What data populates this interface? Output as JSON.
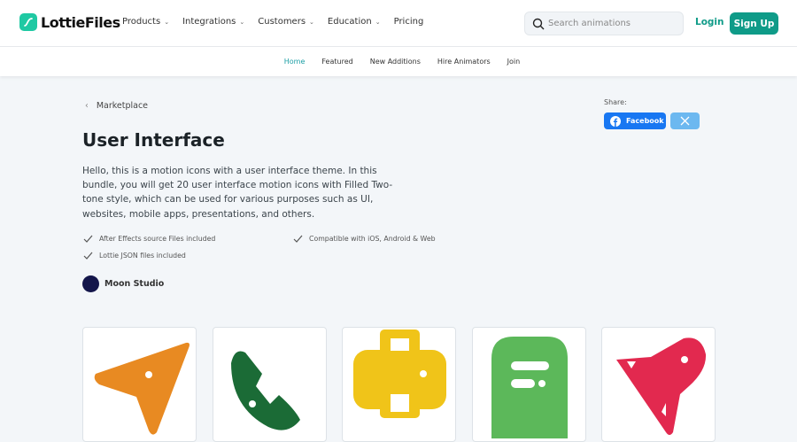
{
  "header": {
    "logo": "LottieFiles",
    "nav": [
      {
        "label": "Products",
        "dropdown": true
      },
      {
        "label": "Integrations",
        "dropdown": true
      },
      {
        "label": "Customers",
        "dropdown": true
      },
      {
        "label": "Education",
        "dropdown": true
      },
      {
        "label": "Pricing",
        "dropdown": false
      }
    ],
    "search_placeholder": "Search animations",
    "login": "Login",
    "signup": "Sign Up"
  },
  "subnav": {
    "items": [
      "Home",
      "Featured",
      "New Additions",
      "Hire Animators",
      "Join"
    ],
    "active": "Home"
  },
  "breadcrumb": "Marketplace",
  "title": "User Interface",
  "description": "Hello, this is a motion icons with a user interface theme. In this bundle, you will get 20 user interface motion icons with Filled Two-tone style, which can be used for various purposes such as UI, websites, mobile apps, presentations, and others.",
  "features": [
    "After Effects source Files included",
    "Compatible with iOS, Android & Web",
    "Lottie JSON files included"
  ],
  "author": "Moon Studio",
  "share": {
    "label": "Share:",
    "facebook": "Facebook"
  },
  "cards": [
    {
      "icon": "send-icon",
      "color": "#e88a22"
    },
    {
      "icon": "phone-icon",
      "color": "#1b6b36"
    },
    {
      "icon": "briefcase-icon",
      "color": "#f0c419"
    },
    {
      "icon": "ghost-chat-icon",
      "color": "#5cb85a"
    },
    {
      "icon": "rocket-icon",
      "color": "#e2294f"
    }
  ]
}
